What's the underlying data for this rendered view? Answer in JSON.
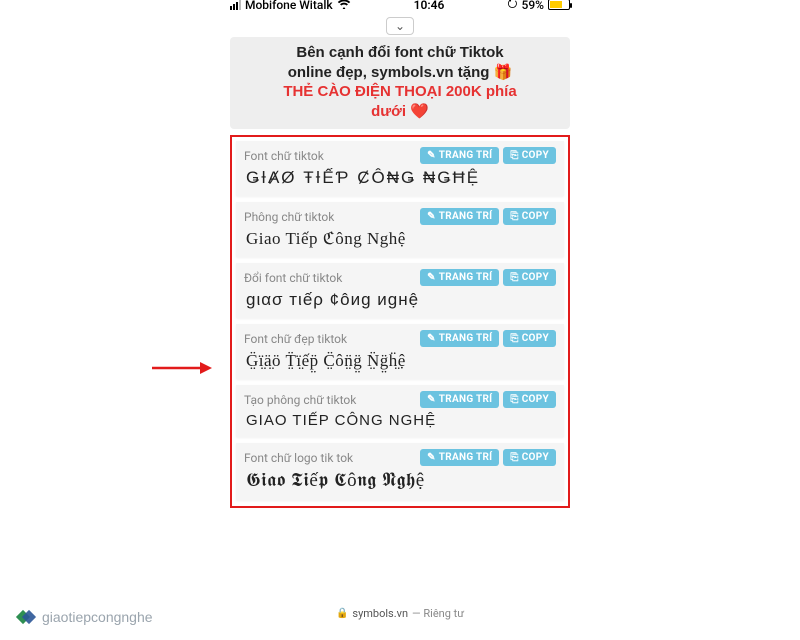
{
  "status": {
    "carrier": "Mobifone Witalk",
    "time": "10:46",
    "battery_percent": "59%",
    "battery_circle": "⭮"
  },
  "collapse_icon": "⌄",
  "headline": {
    "line1": "Bên cạnh đổi font chữ Tiktok",
    "line2": "online đẹp, symbols.vn tặng 🎁",
    "line3_red": "THẺ CÀO ĐIỆN THOẠI 200K phía",
    "line4_red": "dưới ❤️"
  },
  "buttons": {
    "decorate": "TRANG TRÍ",
    "copy": "COPY",
    "decorate_icon": "✎",
    "copy_icon": "⎘"
  },
  "items": [
    {
      "label": "Font chữ tiktok",
      "preview": "ǤƗȺØ ŦƗẾƤ ȻÔ₦Ǥ ₦ǤĦỆ"
    },
    {
      "label": "Phông chữ tiktok",
      "preview": "Giao Tiếp ℭông Nghệ"
    },
    {
      "label": "Đổi font chữ tiktok",
      "preview": "gιασ тιếρ ¢ôиg иgнệ"
    },
    {
      "label": "Font chữ đẹp tiktok",
      "preview": "G̤̈ï̤ä̤ö T̤̈ï̤ếp̤̈ C̤̈ôn̤̈g̤̈ N̤̈g̤̈ḧ̤ệ"
    },
    {
      "label": "Tạo phông chữ tiktok",
      "preview": "GIAO TIẾP CÔNG NGHỆ"
    },
    {
      "label": "Font chữ logo tik tok",
      "preview": "𝕲𝖎𝖆𝖔 𝕿𝖎ế𝖕 𝕮ô𝖓𝖌 𝕹𝖌𝖍ệ"
    }
  ],
  "bottombar": {
    "site": "symbols.vn",
    "privacy": "— Riêng tư",
    "lock": "🔒"
  },
  "watermark": "giaotiepcongnghe"
}
